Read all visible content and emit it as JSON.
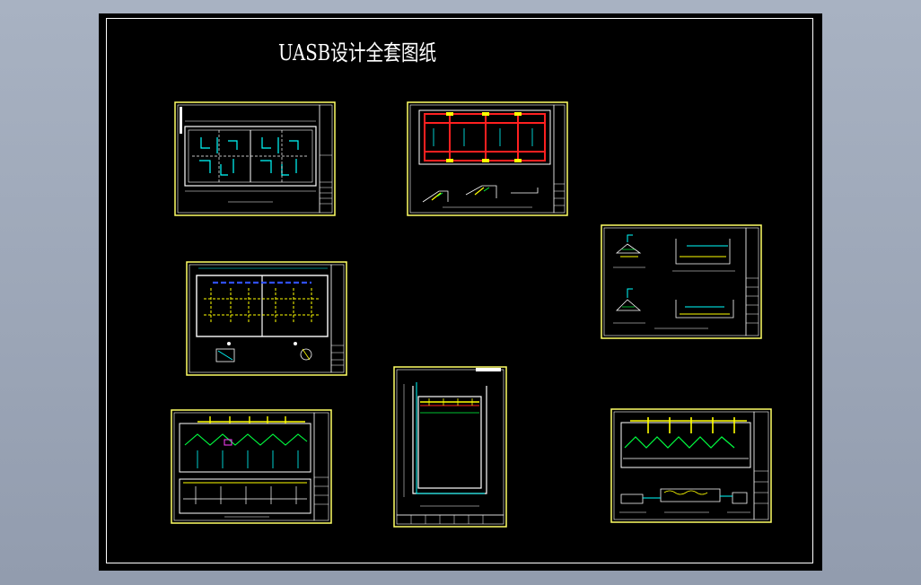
{
  "title": "UASB设计全套图纸",
  "colors": {
    "background": "#98a2b3",
    "canvas": "#000000",
    "frame": "#ffffff",
    "sheet_border": "#ffff66",
    "line_white": "#ffffff",
    "line_cyan": "#00ffff",
    "line_yellow": "#ffff00",
    "line_red": "#ff2020",
    "line_green": "#00ff40",
    "line_blue": "#3050ff",
    "line_magenta": "#ff40ff"
  },
  "sheets": [
    {
      "id": "sheet-1",
      "content": "plan-cyan"
    },
    {
      "id": "sheet-2",
      "content": "plan-red"
    },
    {
      "id": "sheet-3",
      "content": "plan-blue"
    },
    {
      "id": "sheet-4",
      "content": "details"
    },
    {
      "id": "sheet-5",
      "content": "section-hoods"
    },
    {
      "id": "sheet-6",
      "content": "section-tall"
    },
    {
      "id": "sheet-7",
      "content": "section-hoods-2"
    }
  ]
}
